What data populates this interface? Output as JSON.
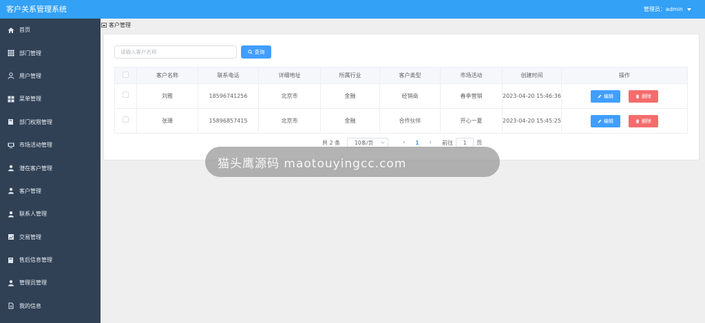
{
  "app": {
    "title": "客户关系管理系统",
    "user_label": "管理员：admin"
  },
  "sidebar": {
    "items": [
      {
        "label": "首页",
        "icon": "home-icon"
      },
      {
        "label": "部门管理",
        "icon": "grid-icon"
      },
      {
        "label": "用户管理",
        "icon": "user-icon"
      },
      {
        "label": "菜单管理",
        "icon": "menu-grid-icon"
      },
      {
        "label": "部门权限管理",
        "icon": "book-icon"
      },
      {
        "label": "市场活动管理",
        "icon": "monitor-icon"
      },
      {
        "label": "潜在客户管理",
        "icon": "person-icon"
      },
      {
        "label": "客户管理",
        "icon": "person-icon"
      },
      {
        "label": "联系人管理",
        "icon": "person-icon"
      },
      {
        "label": "交易管理",
        "icon": "chart-icon"
      },
      {
        "label": "售后信息管理",
        "icon": "book-icon"
      },
      {
        "label": "管理员管理",
        "icon": "person-icon"
      },
      {
        "label": "我的信息",
        "icon": "document-icon"
      }
    ]
  },
  "breadcrumb": {
    "label": "客户管理"
  },
  "search": {
    "placeholder": "请输入客户名称",
    "value": "",
    "button_label": "查询"
  },
  "table": {
    "headers": [
      "客户名称",
      "联系电话",
      "详细地址",
      "所属行业",
      "客户类型",
      "市场活动",
      "创建时间",
      "操作"
    ],
    "rows": [
      {
        "name": "刘雅",
        "phone": "18596741256",
        "address": "北京市",
        "industry": "金融",
        "type": "经销商",
        "activity": "春季营销",
        "created": "2023-04-20 15:46:36"
      },
      {
        "name": "张珊",
        "phone": "15896857415",
        "address": "北京市",
        "industry": "金融",
        "type": "合作伙伴",
        "activity": "开心一夏",
        "created": "2023-04-20 15:45:25"
      }
    ],
    "edit_label": "编辑",
    "delete_label": "删除"
  },
  "pagination": {
    "total_text": "共 2 条",
    "page_size": "10条/页",
    "current_page": "1",
    "jump_prefix": "前往",
    "jump_value": "1",
    "jump_suffix": "页"
  },
  "watermark": {
    "text": "猫头鹰源码 maotouyingcc.com"
  }
}
